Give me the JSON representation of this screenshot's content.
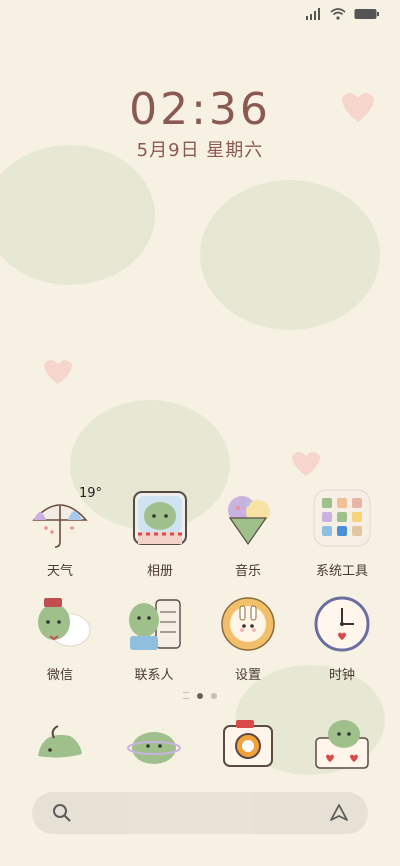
{
  "status_bar": {
    "signal_icon": "signal-icon",
    "wifi_icon": "wifi-icon",
    "battery_icon": "battery-icon"
  },
  "lock": {
    "time": "02:36",
    "date": "5月9日  星期六"
  },
  "apps": [
    {
      "label": "天气",
      "icon": "weather-umbrella-icon",
      "badge": "19°"
    },
    {
      "label": "相册",
      "icon": "gallery-dino-icon"
    },
    {
      "label": "音乐",
      "icon": "music-icecream-icon"
    },
    {
      "label": "系统工具",
      "icon": "system-tools-folder-icon"
    },
    {
      "label": "微信",
      "icon": "wechat-dino-icon"
    },
    {
      "label": "联系人",
      "icon": "contacts-dino-icon"
    },
    {
      "label": "设置",
      "icon": "settings-bunny-icon"
    },
    {
      "label": "时钟",
      "icon": "clock-icon"
    }
  ],
  "dock": [
    {
      "icon": "phone-dino-icon"
    },
    {
      "icon": "messages-dino-icon"
    },
    {
      "icon": "camera-icon"
    },
    {
      "icon": "browser-dino-icon"
    }
  ],
  "colors": {
    "background": "#f7f1e4",
    "dino_green": "#9fc08a",
    "text_brown": "#8a5a52"
  }
}
